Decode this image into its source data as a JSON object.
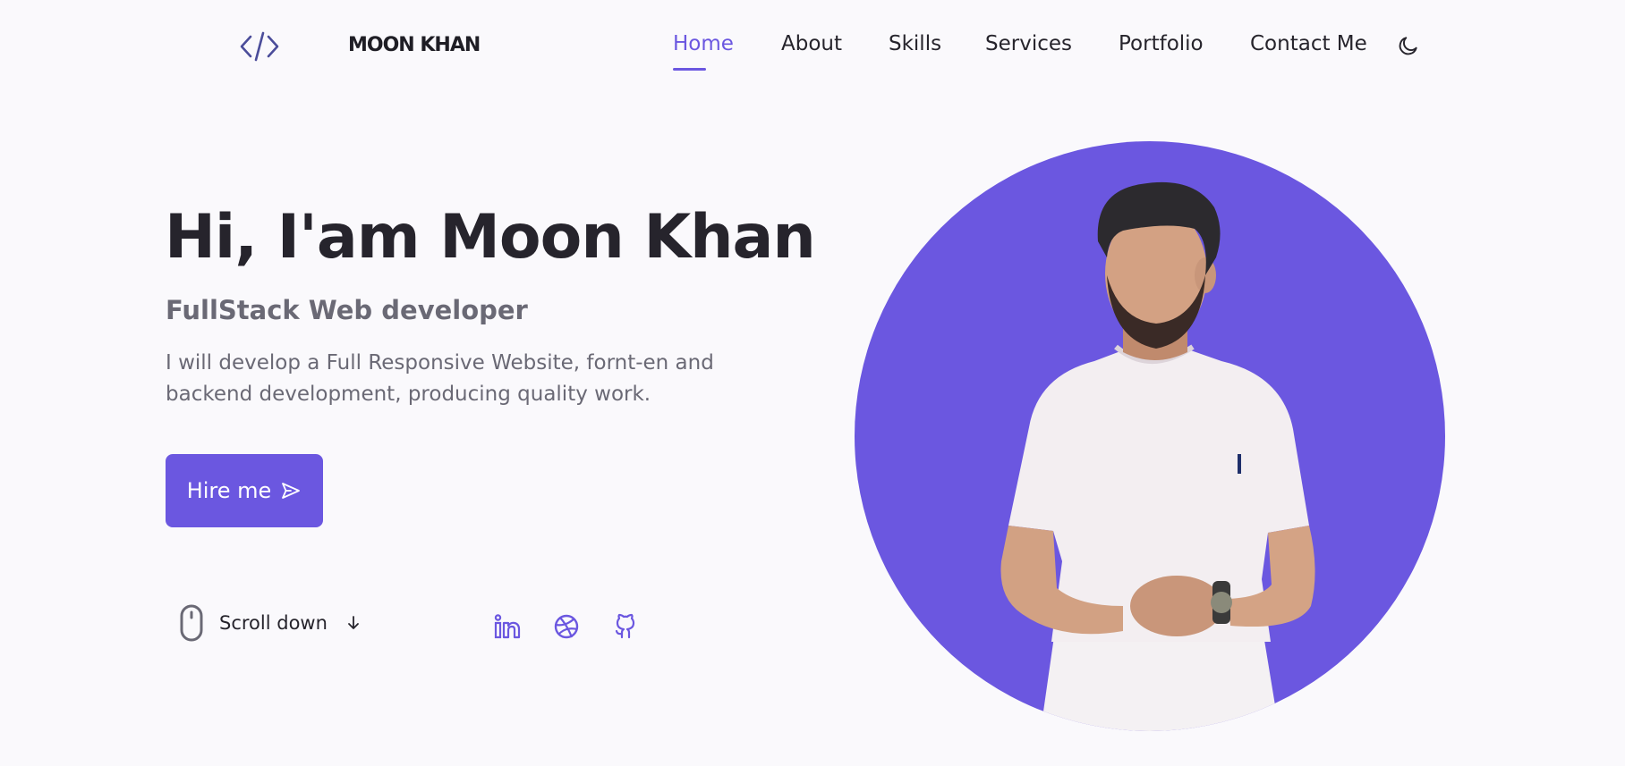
{
  "header": {
    "logo_icon": "code-icon",
    "brand": "MOON KHAN",
    "nav": [
      {
        "label": "Home",
        "active": true
      },
      {
        "label": "About",
        "active": false
      },
      {
        "label": "Skills",
        "active": false
      },
      {
        "label": "Services",
        "active": false
      },
      {
        "label": "Portfolio",
        "active": false
      },
      {
        "label": "Contact Me",
        "active": false
      }
    ],
    "theme_toggle_icon": "moon-icon"
  },
  "hero": {
    "title": "Hi, I'am Moon Khan",
    "subtitle": "FullStack Web developer",
    "description": "I will develop a Full Responsive Website, fornt-en and backend development, producing quality work.",
    "hire_button": {
      "label": "Hire me",
      "icon": "send-icon"
    },
    "scroll": {
      "label": "Scroll down",
      "icons": [
        "mouse-icon",
        "arrow-down-icon"
      ]
    },
    "social": [
      {
        "icon": "linkedin-icon"
      },
      {
        "icon": "dribbble-icon"
      },
      {
        "icon": "github-icon"
      }
    ],
    "image": {
      "description": "profile-photo"
    }
  },
  "colors": {
    "accent": "#6b57e0",
    "background": "#faf9fc",
    "heading": "#26242c",
    "text_muted": "#6a6975"
  }
}
